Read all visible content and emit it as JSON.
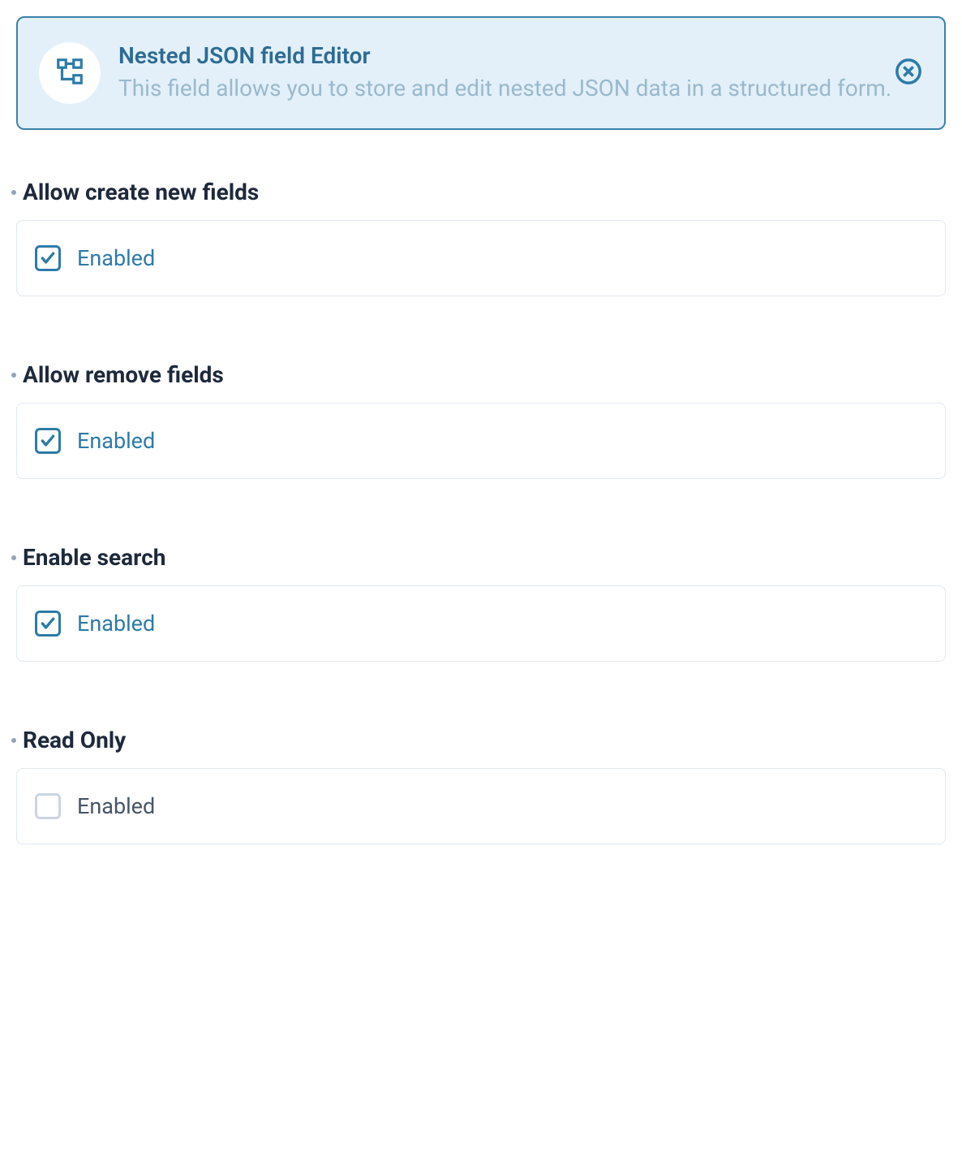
{
  "banner": {
    "title": "Nested JSON field Editor",
    "description": "This field allows you to store and edit nested JSON data in a structured form."
  },
  "fields": [
    {
      "label": "Allow create new fields",
      "option_label": "Enabled",
      "checked": true
    },
    {
      "label": "Allow remove fields",
      "option_label": "Enabled",
      "checked": true
    },
    {
      "label": "Enable search",
      "option_label": "Enabled",
      "checked": true
    },
    {
      "label": "Read Only",
      "option_label": "Enabled",
      "checked": false
    }
  ]
}
